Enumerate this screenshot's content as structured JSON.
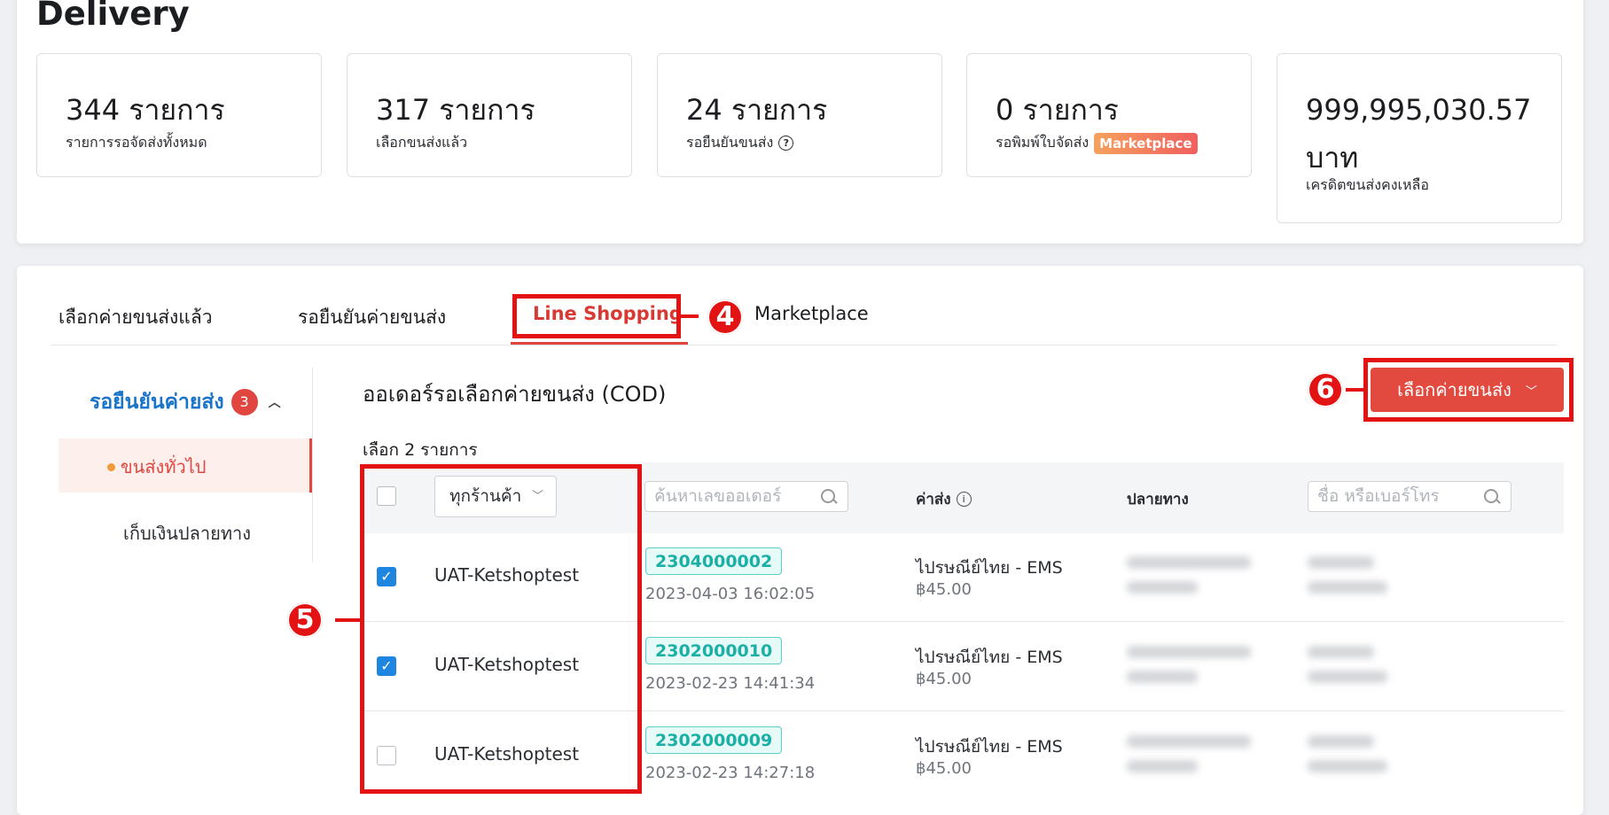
{
  "page": {
    "title": "Delivery"
  },
  "stats": [
    {
      "value": "344 รายการ",
      "label": "รายการรอจัดส่งทั้งหมด"
    },
    {
      "value": "317 รายการ",
      "label": "เลือกขนส่งแล้ว"
    },
    {
      "value": "24 รายการ",
      "label": "รอยืนยันขนส่ง",
      "icon": "help-circle-icon"
    },
    {
      "value": "0 รายการ",
      "label": "รอพิมพ์ใบจัดส่ง",
      "badge": "Marketplace"
    },
    {
      "value": "999,995,030.57 บาท",
      "label": "เครดิตขนส่งคงเหลือ"
    }
  ],
  "tabs": [
    {
      "label": "เลือกค่ายขนส่งแล้ว"
    },
    {
      "label": "รอยืนยันค่ายขนส่ง"
    },
    {
      "label": "Line Shopping",
      "active": true
    },
    {
      "label": "Marketplace"
    }
  ],
  "annotations": {
    "a4": "4",
    "a5": "5",
    "a6": "6"
  },
  "sidebar": {
    "heading": "รอยืนยันค่ายส่ง",
    "count": "3",
    "items": [
      {
        "label": "ขนส่งทั่วไป",
        "active": true
      },
      {
        "label": "เก็บเงินปลายทาง"
      }
    ]
  },
  "main": {
    "title": "ออเดอร์รอเลือกค่ายขนส่ง (COD)",
    "selected": "เลือก 2 รายการ",
    "primary_button": "เลือกค่ายขนส่ง"
  },
  "table": {
    "store_filter": "ทุกร้านค้า",
    "order_search_placeholder": "ค้นหาเลขออเดอร์",
    "col_shipping": "ค่าส่ง",
    "col_destination": "ปลายทาง",
    "destination_search_placeholder": "ชื่อ หรือเบอร์โทร",
    "rows": [
      {
        "checked": true,
        "store": "UAT-Ketshoptest",
        "order_no": "2304000002",
        "time": "2023-04-03 16:02:05",
        "carrier": "ไปรษณีย์ไทย - EMS",
        "fee": "฿45.00"
      },
      {
        "checked": true,
        "store": "UAT-Ketshoptest",
        "order_no": "2302000010",
        "time": "2023-02-23 14:41:34",
        "carrier": "ไปรษณีย์ไทย - EMS",
        "fee": "฿45.00"
      },
      {
        "checked": false,
        "store": "UAT-Ketshoptest",
        "order_no": "2302000009",
        "time": "2023-02-23 14:27:18",
        "carrier": "ไปรษณีย์ไทย - EMS",
        "fee": "฿45.00"
      }
    ]
  },
  "colors": {
    "accent": "#e34a3f",
    "link": "#1a74c9",
    "annotation": "#e41313",
    "teal": "#1bb0a6"
  }
}
